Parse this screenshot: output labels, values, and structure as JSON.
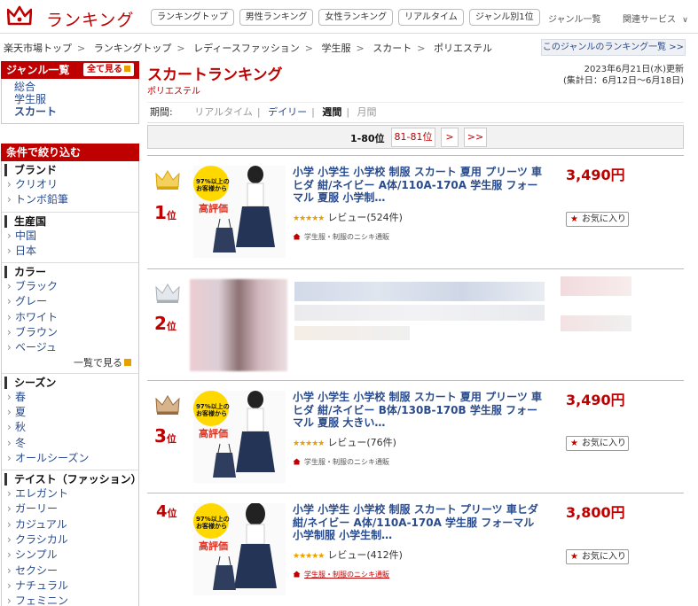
{
  "header": {
    "logo_text": "ランキング",
    "buttons": [
      "ランキングトップ",
      "男性ランキング",
      "女性ランキング",
      "リアルタイム",
      "ジャンル別1位"
    ],
    "genre_list": "ジャンル一覧",
    "related": "関連サービス"
  },
  "breadcrumb": [
    "楽天市場トップ",
    "ランキングトップ",
    "レディースファッション",
    "学生服",
    "スカート",
    "ポリエステル"
  ],
  "genre_list_link": "このジャンルのランキング一覧 >>",
  "sidebar": {
    "genre_head": "ジャンル一覧",
    "all_view": "全て見る",
    "genres": [
      "総合",
      "学生服",
      "スカート"
    ],
    "filter_head": "条件で絞り込む",
    "sections": [
      {
        "title": "ブランド",
        "items": [
          "クリオリ",
          "トンボ鉛筆"
        ],
        "more": ""
      },
      {
        "title": "生産国",
        "items": [
          "中国",
          "日本"
        ],
        "more": ""
      },
      {
        "title": "カラー",
        "items": [
          "ブラック",
          "グレー",
          "ホワイト",
          "ブラウン",
          "ベージュ"
        ],
        "more": "一覧で見る"
      },
      {
        "title": "シーズン",
        "items": [
          "春",
          "夏",
          "秋",
          "冬",
          "オールシーズン"
        ],
        "more": ""
      },
      {
        "title": "テイスト（ファッション）",
        "items": [
          "エレガント",
          "ガーリー",
          "カジュアル",
          "クラシカル",
          "シンプル",
          "セクシー",
          "ナチュラル",
          "フェミニン"
        ],
        "more": ""
      }
    ]
  },
  "main": {
    "title": "スカートランキング",
    "subgenre": "ポリエステル",
    "date_line1": "2023年6月21日(水)更新",
    "date_line2": "(集計日：6月12日～6月18日)",
    "period_label": "期間:",
    "periods": [
      "リアルタイム",
      "デイリー",
      "週間",
      "月間"
    ],
    "pager_range": "1-80位",
    "pager_next": "81-81位",
    "pager_gt": ">",
    "pager_last": ">>"
  },
  "items": [
    {
      "rank": "1",
      "rank_suffix": "位",
      "title": "小学 小学生 小学校 制服 スカート 夏用 プリーツ 車ヒダ 紺/ネイビー A体/110A-170A 学生服 フォーマル 夏服 小学制…",
      "price": "3,490円",
      "review": "レビュー(524件)",
      "shop": "学生服・制服のニシキ通販",
      "fav": "お気に入り",
      "thumb_text": [
        "97%以上の",
        "お客様から",
        "高評価"
      ]
    },
    {
      "rank": "2",
      "rank_suffix": "位",
      "title": "",
      "price": "",
      "review": "",
      "shop": "",
      "fav": ""
    },
    {
      "rank": "3",
      "rank_suffix": "位",
      "title": "小学 小学生 小学校 制服 スカート 夏用 プリーツ 車ヒダ 紺/ネイビー B体/130B-170B 学生服 フォーマル 夏服 大きい…",
      "price": "3,490円",
      "review": "レビュー(76件)",
      "shop": "学生服・制服のニシキ通販",
      "fav": "お気に入り",
      "thumb_text": [
        "97%以上の",
        "お客様から",
        "高評価"
      ]
    },
    {
      "rank": "4",
      "rank_suffix": "位",
      "title": "小学 小学生 小学校 制服 スカート プリーツ 車ヒダ 紺/ネイビー A体/110A-170A 学生服 フォーマル 小学制服 小学生制…",
      "price": "3,800円",
      "review": "レビュー(412件)",
      "shop": "学生服・制服のニシキ通販",
      "fav": "お気に入り",
      "thumb_text": [
        "97%以上の",
        "お客様から",
        "高評価"
      ]
    }
  ],
  "colors": {
    "brand": "#bf0000",
    "link": "#2b4c8c",
    "gold": "#e8a000"
  }
}
